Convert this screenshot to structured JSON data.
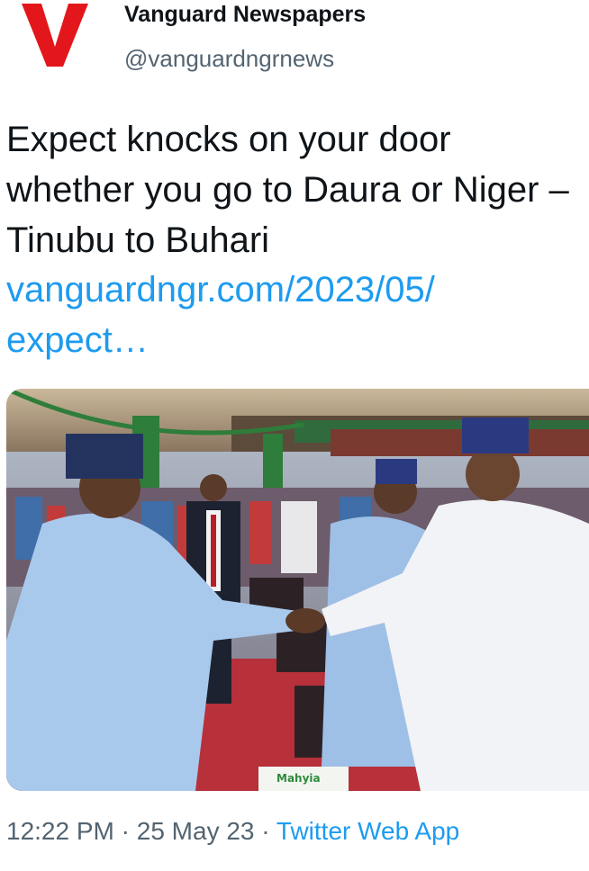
{
  "account": {
    "logo_letter": "V",
    "name": "Vanguard Newspapers",
    "handle": "@vanguardngrnews"
  },
  "tweet": {
    "text": "Expect knocks on your door whether you go to Daura or Niger – Tinubu to Buhari",
    "link": "vanguardngr.com/2023/05/\nexpect…",
    "time": "12:22 PM",
    "sep1": " · ",
    "date": "25 May 23",
    "sep2": " · ",
    "app": "Twitter Web App"
  },
  "media": {
    "brochure_text": "Mahyia"
  },
  "colors": {
    "logo_red": "#e3171b",
    "link_blue": "#1d9bf0",
    "secondary_gray": "#536471"
  }
}
